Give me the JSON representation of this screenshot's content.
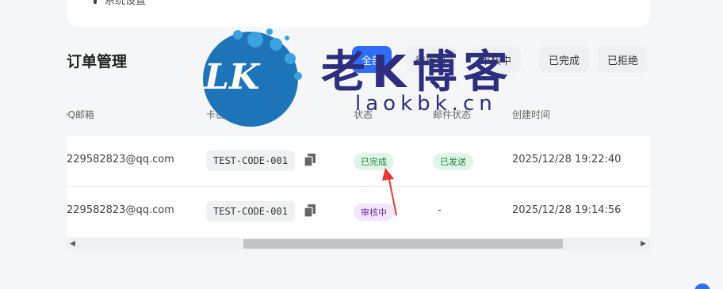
{
  "top_card": {
    "item_label": "系统设置"
  },
  "page": {
    "title": "订单管理"
  },
  "filters": [
    {
      "label": "全部",
      "active": true
    },
    {
      "label": "待审核",
      "active": false
    },
    {
      "label": "审核中",
      "active": false
    },
    {
      "label": "已完成",
      "active": false
    },
    {
      "label": "已拒绝",
      "active": false
    }
  ],
  "table": {
    "headers": [
      "QQ邮箱",
      "卡密",
      "状态",
      "邮件状态",
      "创建时间"
    ],
    "rows": [
      {
        "email": "229582823@qq.com",
        "card_code": "TEST-CODE-001",
        "status": "已完成",
        "mail_status": "已发送",
        "created": "2025/12/28 19:22:40"
      },
      {
        "email": "229582823@qq.com",
        "card_code": "TEST-CODE-001",
        "status": "审核中",
        "mail_status": "-",
        "created": "2025/12/28 19:14:56"
      }
    ]
  },
  "watermark": {
    "logo": "LK",
    "title": "老K博客",
    "url": "laokbk.cn"
  },
  "colors": {
    "accent": "#2f6df6",
    "success_bg": "#dff5e6",
    "success_text": "#1a7f43",
    "pending_bg": "#f1e6fb",
    "pending_text": "#7a2ea8",
    "watermark": "#2e2e7e"
  },
  "icons": {
    "copy": "copy-icon",
    "arrow": "annotation-arrow"
  }
}
